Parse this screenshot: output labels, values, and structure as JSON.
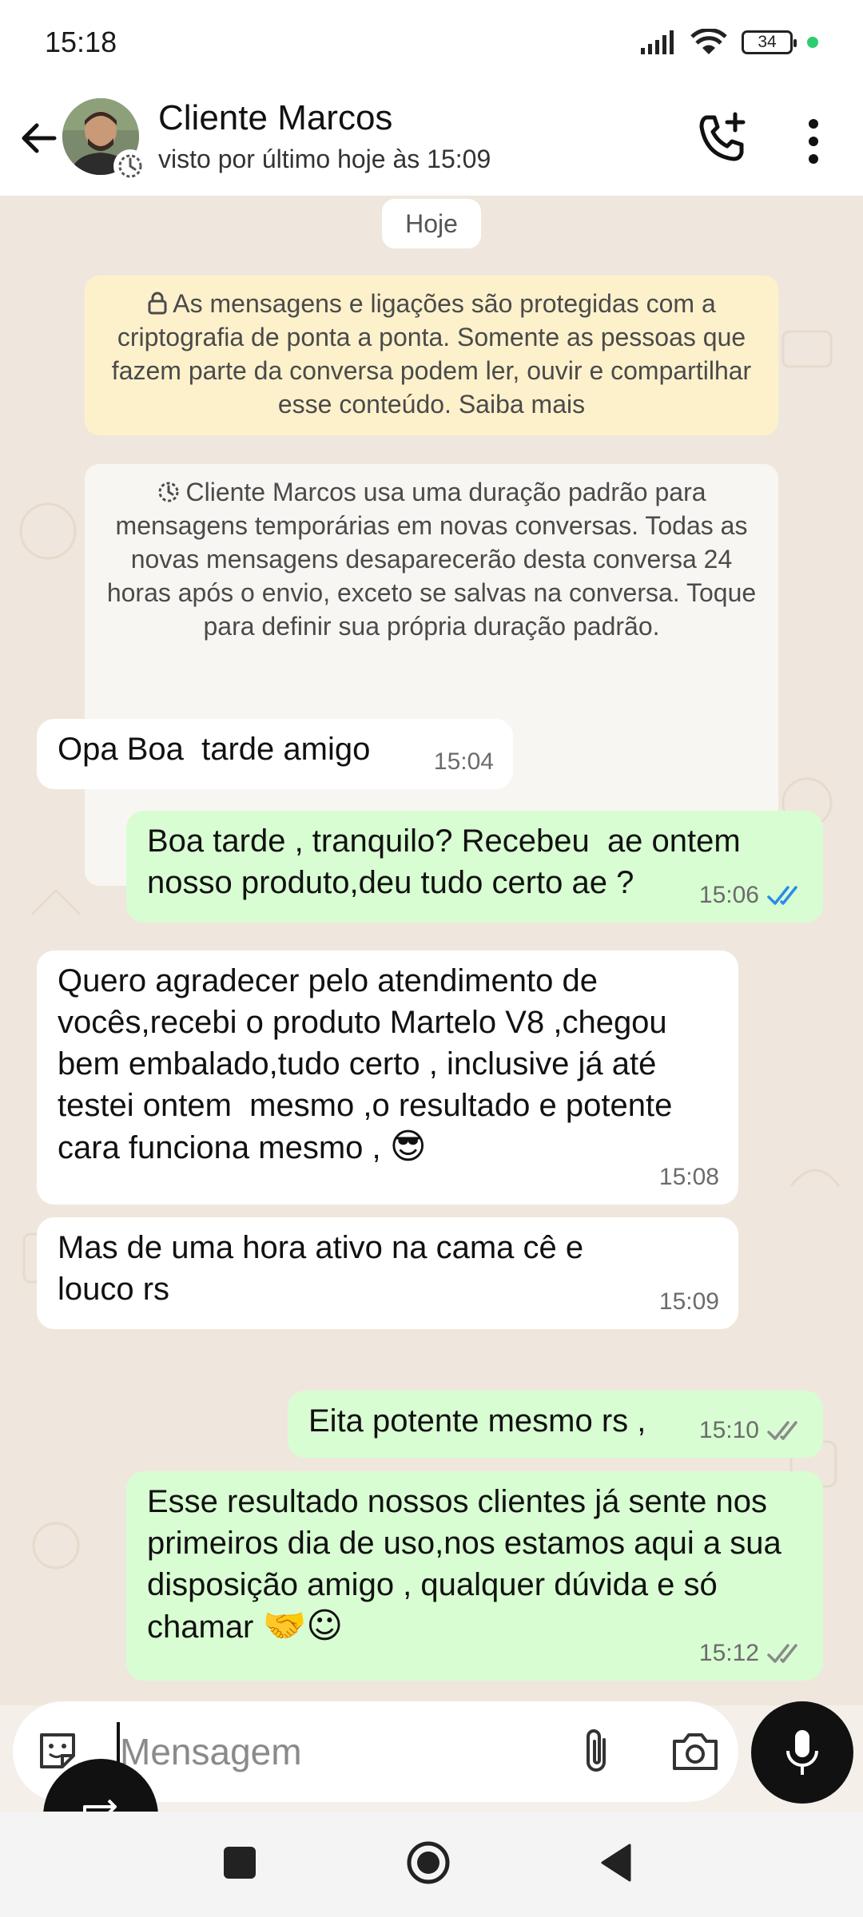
{
  "status_bar": {
    "time": "15:18",
    "battery": "34"
  },
  "header": {
    "contact_name": "Cliente Marcos",
    "contact_status": "visto por último hoje às 15:09"
  },
  "chat": {
    "date_chip": "Hoje",
    "notice_crypto": "As mensagens e ligações são protegidas com a criptografia de ponta a ponta. Somente as pessoas que fazem parte da conversa podem ler, ouvir e compartilhar esse conteúdo. Saiba mais",
    "notice_temporary": "Cliente Marcos usa uma duração padrão para mensagens temporárias em novas conversas. Todas as novas mensagens desaparecerão desta conversa 24 horas após o envio, exceto se salvas na conversa. Toque para definir sua própria duração padrão.",
    "messages": [
      {
        "direction": "in",
        "text": "Opa Boa  tarde amigo",
        "time": "15:04"
      },
      {
        "direction": "out",
        "text": "Boa tarde , tranquilo? Recebeu  ae ontem nosso produto,deu tudo certo ae ?",
        "time": "15:06",
        "status": "read"
      },
      {
        "direction": "in",
        "text": "Quero agradecer pelo atendimento de vocês,recebi o produto Martelo V8 ,chegou bem embalado,tudo certo , inclusive já até testei ontem  mesmo ,o resultado e potente cara funciona mesmo ,",
        "emoji": "😎",
        "time": "15:08"
      },
      {
        "direction": "in",
        "text": "Mas de uma hora ativo na cama cê e louco rs",
        "time": "15:09"
      },
      {
        "direction": "out",
        "text": "Eita potente mesmo rs ,",
        "time": "15:10",
        "status": "delivered"
      },
      {
        "direction": "out",
        "text": "Esse resultado nossos clientes já sente nos primeiros dia de uso,nos estamos aqui a sua disposição amigo , qualquer dúvida e só chamar",
        "emoji": "🤝☺",
        "time": "15:12",
        "status": "delivered"
      }
    ]
  },
  "input": {
    "placeholder": "Mensagem",
    "value": ""
  },
  "colors": {
    "outgoing_bubble": "#d8fdd2",
    "incoming_bubble": "#ffffff",
    "notice_yellow": "#fdf1cc",
    "read_tick": "#2a8ce8",
    "delivered_tick": "#8a8a8a",
    "chat_background": "#efe7dd"
  },
  "icons": [
    "back-arrow-icon",
    "timer-icon",
    "add-call-icon",
    "more-vert-icon",
    "lock-icon",
    "sticker-icon",
    "attach-icon",
    "camera-icon",
    "mic-icon",
    "swap-icon",
    "nav-recents-icon",
    "nav-home-icon",
    "nav-back-icon",
    "double-check-icon"
  ]
}
